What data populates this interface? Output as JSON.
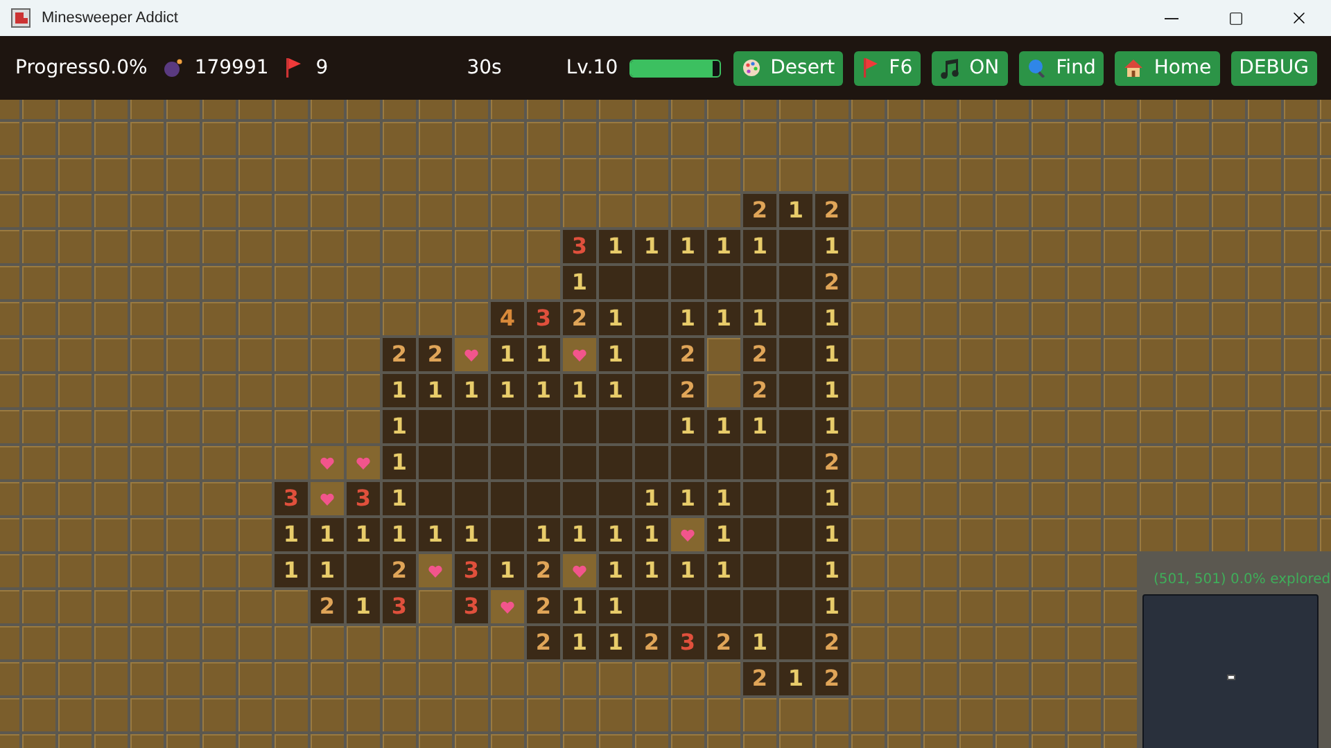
{
  "window": {
    "title": "Minesweeper Addict"
  },
  "toolbar": {
    "progress": "Progress0.0%",
    "mines": "179991",
    "flags": "9",
    "timer": "30s",
    "level_label": "Lv.10",
    "level": 0.92,
    "buttons": [
      {
        "label": "Desert"
      },
      {
        "label": "F6"
      },
      {
        "label": "ON"
      },
      {
        "label": "Find"
      },
      {
        "label": "Home"
      },
      {
        "label": "DEBUG"
      }
    ]
  },
  "board": {
    "rows": [
      {
        "cells": [
          {
            "kind": "hidden"
          },
          {
            "kind": "hidden"
          },
          {
            "kind": "hidden"
          },
          {
            "kind": "hidden"
          },
          {
            "kind": "hidden"
          },
          {
            "kind": "hidden"
          },
          {
            "kind": "hidden"
          },
          {
            "kind": "hidden"
          },
          {
            "kind": "hidden"
          },
          {
            "kind": "hidden"
          },
          {
            "kind": "hidden"
          },
          {
            "kind": "hidden"
          },
          {
            "kind": "hidden"
          },
          {
            "kind": "number",
            "text": "2",
            "color": "#e0a558"
          },
          {
            "kind": "number",
            "text": "1",
            "color": "#e8cc6a"
          },
          {
            "kind": "number",
            "text": "2",
            "color": "#e0a558"
          }
        ]
      },
      {
        "cells": [
          {
            "kind": "hidden"
          },
          {
            "kind": "hidden"
          },
          {
            "kind": "hidden"
          },
          {
            "kind": "hidden"
          },
          {
            "kind": "hidden"
          },
          {
            "kind": "hidden"
          },
          {
            "kind": "hidden"
          },
          {
            "kind": "hidden"
          },
          {
            "kind": "number",
            "text": "3",
            "color": "#e0503c"
          },
          {
            "kind": "number",
            "text": "1",
            "color": "#e8cc6a"
          },
          {
            "kind": "number",
            "text": "1",
            "color": "#e8cc6a"
          },
          {
            "kind": "number",
            "text": "1",
            "color": "#e8cc6a"
          },
          {
            "kind": "number",
            "text": "1",
            "color": "#e8cc6a"
          },
          {
            "kind": "number",
            "text": "1",
            "color": "#e8cc6a"
          },
          {
            "kind": "open"
          },
          {
            "kind": "number",
            "text": "1",
            "color": "#e8cc6a"
          }
        ]
      },
      {
        "cells": [
          {
            "kind": "hidden"
          },
          {
            "kind": "hidden"
          },
          {
            "kind": "hidden"
          },
          {
            "kind": "hidden"
          },
          {
            "kind": "hidden"
          },
          {
            "kind": "hidden"
          },
          {
            "kind": "hidden"
          },
          {
            "kind": "hidden"
          },
          {
            "kind": "number",
            "text": "1",
            "color": "#e8cc6a"
          },
          {
            "kind": "open"
          },
          {
            "kind": "open"
          },
          {
            "kind": "open"
          },
          {
            "kind": "open"
          },
          {
            "kind": "open"
          },
          {
            "kind": "open"
          },
          {
            "kind": "number",
            "text": "2",
            "color": "#e0a558"
          }
        ]
      },
      {
        "cells": [
          {
            "kind": "hidden"
          },
          {
            "kind": "hidden"
          },
          {
            "kind": "hidden"
          },
          {
            "kind": "hidden"
          },
          {
            "kind": "hidden"
          },
          {
            "kind": "hidden"
          },
          {
            "kind": "number",
            "text": "4",
            "color": "#d98a3a"
          },
          {
            "kind": "number",
            "text": "3",
            "color": "#e0503c"
          },
          {
            "kind": "number",
            "text": "2",
            "color": "#e0a558"
          },
          {
            "kind": "number",
            "text": "1",
            "color": "#e8cc6a"
          },
          {
            "kind": "open"
          },
          {
            "kind": "number",
            "text": "1",
            "color": "#e8cc6a"
          },
          {
            "kind": "number",
            "text": "1",
            "color": "#e8cc6a"
          },
          {
            "kind": "number",
            "text": "1",
            "color": "#e8cc6a"
          },
          {
            "kind": "open"
          },
          {
            "kind": "number",
            "text": "1",
            "color": "#e8cc6a"
          }
        ]
      },
      {
        "cells": [
          {
            "kind": "hidden"
          },
          {
            "kind": "hidden"
          },
          {
            "kind": "hidden"
          },
          {
            "kind": "number",
            "text": "2",
            "color": "#e0a558"
          },
          {
            "kind": "number",
            "text": "2",
            "color": "#e0a558"
          },
          {
            "kind": "flag"
          },
          {
            "kind": "number",
            "text": "1",
            "color": "#e8cc6a"
          },
          {
            "kind": "number",
            "text": "1",
            "color": "#e8cc6a"
          },
          {
            "kind": "flag"
          },
          {
            "kind": "number",
            "text": "1",
            "color": "#e8cc6a"
          },
          {
            "kind": "open"
          },
          {
            "kind": "number",
            "text": "2",
            "color": "#e0a558"
          },
          {
            "kind": "hidden"
          },
          {
            "kind": "number",
            "text": "2",
            "color": "#e0a558"
          },
          {
            "kind": "open"
          },
          {
            "kind": "number",
            "text": "1",
            "color": "#e8cc6a"
          }
        ]
      },
      {
        "cells": [
          {
            "kind": "hidden"
          },
          {
            "kind": "hidden"
          },
          {
            "kind": "hidden"
          },
          {
            "kind": "number",
            "text": "1",
            "color": "#e8cc6a"
          },
          {
            "kind": "number",
            "text": "1",
            "color": "#e8cc6a"
          },
          {
            "kind": "number",
            "text": "1",
            "color": "#e8cc6a"
          },
          {
            "kind": "number",
            "text": "1",
            "color": "#e8cc6a"
          },
          {
            "kind": "number",
            "text": "1",
            "color": "#e8cc6a"
          },
          {
            "kind": "number",
            "text": "1",
            "color": "#e8cc6a"
          },
          {
            "kind": "number",
            "text": "1",
            "color": "#e8cc6a"
          },
          {
            "kind": "open"
          },
          {
            "kind": "number",
            "text": "2",
            "color": "#e0a558"
          },
          {
            "kind": "hidden"
          },
          {
            "kind": "number",
            "text": "2",
            "color": "#e0a558"
          },
          {
            "kind": "open"
          },
          {
            "kind": "number",
            "text": "1",
            "color": "#e8cc6a"
          }
        ]
      },
      {
        "cells": [
          {
            "kind": "hidden"
          },
          {
            "kind": "hidden"
          },
          {
            "kind": "hidden"
          },
          {
            "kind": "number",
            "text": "1",
            "color": "#e8cc6a"
          },
          {
            "kind": "open"
          },
          {
            "kind": "open"
          },
          {
            "kind": "open"
          },
          {
            "kind": "open"
          },
          {
            "kind": "open"
          },
          {
            "kind": "open"
          },
          {
            "kind": "open"
          },
          {
            "kind": "number",
            "text": "1",
            "color": "#e8cc6a"
          },
          {
            "kind": "number",
            "text": "1",
            "color": "#e8cc6a"
          },
          {
            "kind": "number",
            "text": "1",
            "color": "#e8cc6a"
          },
          {
            "kind": "open"
          },
          {
            "kind": "number",
            "text": "1",
            "color": "#e8cc6a"
          }
        ]
      },
      {
        "cells": [
          {
            "kind": "hidden"
          },
          {
            "kind": "flag"
          },
          {
            "kind": "flag"
          },
          {
            "kind": "number",
            "text": "1",
            "color": "#e8cc6a"
          },
          {
            "kind": "open"
          },
          {
            "kind": "open"
          },
          {
            "kind": "open"
          },
          {
            "kind": "open"
          },
          {
            "kind": "open"
          },
          {
            "kind": "open"
          },
          {
            "kind": "open"
          },
          {
            "kind": "open"
          },
          {
            "kind": "open"
          },
          {
            "kind": "open"
          },
          {
            "kind": "open"
          },
          {
            "kind": "number",
            "text": "2",
            "color": "#e0a558"
          }
        ]
      },
      {
        "cells": [
          {
            "kind": "number",
            "text": "3",
            "color": "#e0503c"
          },
          {
            "kind": "flag"
          },
          {
            "kind": "number",
            "text": "3",
            "color": "#e0503c"
          },
          {
            "kind": "number",
            "text": "1",
            "color": "#e8cc6a"
          },
          {
            "kind": "open"
          },
          {
            "kind": "open"
          },
          {
            "kind": "open"
          },
          {
            "kind": "open"
          },
          {
            "kind": "open"
          },
          {
            "kind": "open"
          },
          {
            "kind": "number",
            "text": "1",
            "color": "#e8cc6a"
          },
          {
            "kind": "number",
            "text": "1",
            "color": "#e8cc6a"
          },
          {
            "kind": "number",
            "text": "1",
            "color": "#e8cc6a"
          },
          {
            "kind": "open"
          },
          {
            "kind": "open"
          },
          {
            "kind": "number",
            "text": "1",
            "color": "#e8cc6a"
          }
        ]
      },
      {
        "cells": [
          {
            "kind": "number",
            "text": "1",
            "color": "#e8cc6a"
          },
          {
            "kind": "number",
            "text": "1",
            "color": "#e8cc6a"
          },
          {
            "kind": "number",
            "text": "1",
            "color": "#e8cc6a"
          },
          {
            "kind": "number",
            "text": "1",
            "color": "#e8cc6a"
          },
          {
            "kind": "number",
            "text": "1",
            "color": "#e8cc6a"
          },
          {
            "kind": "number",
            "text": "1",
            "color": "#e8cc6a"
          },
          {
            "kind": "open"
          },
          {
            "kind": "number",
            "text": "1",
            "color": "#e8cc6a"
          },
          {
            "kind": "number",
            "text": "1",
            "color": "#e8cc6a"
          },
          {
            "kind": "number",
            "text": "1",
            "color": "#e8cc6a"
          },
          {
            "kind": "number",
            "text": "1",
            "color": "#e8cc6a"
          },
          {
            "kind": "flag"
          },
          {
            "kind": "number",
            "text": "1",
            "color": "#e8cc6a"
          },
          {
            "kind": "open"
          },
          {
            "kind": "open"
          },
          {
            "kind": "number",
            "text": "1",
            "color": "#e8cc6a"
          }
        ]
      },
      {
        "cells": [
          {
            "kind": "number",
            "text": "1",
            "color": "#e8cc6a"
          },
          {
            "kind": "number",
            "text": "1",
            "color": "#e8cc6a"
          },
          {
            "kind": "open"
          },
          {
            "kind": "number",
            "text": "2",
            "color": "#e0a558"
          },
          {
            "kind": "flag"
          },
          {
            "kind": "number",
            "text": "3",
            "color": "#e0503c"
          },
          {
            "kind": "number",
            "text": "1",
            "color": "#e8cc6a"
          },
          {
            "kind": "number",
            "text": "2",
            "color": "#e0a558"
          },
          {
            "kind": "flag"
          },
          {
            "kind": "number",
            "text": "1",
            "color": "#e8cc6a"
          },
          {
            "kind": "number",
            "text": "1",
            "color": "#e8cc6a"
          },
          {
            "kind": "number",
            "text": "1",
            "color": "#e8cc6a"
          },
          {
            "kind": "number",
            "text": "1",
            "color": "#e8cc6a"
          },
          {
            "kind": "open"
          },
          {
            "kind": "open"
          },
          {
            "kind": "number",
            "text": "1",
            "color": "#e8cc6a"
          }
        ]
      },
      {
        "cells": [
          {
            "kind": "hidden"
          },
          {
            "kind": "number",
            "text": "2",
            "color": "#e0a558"
          },
          {
            "kind": "number",
            "text": "1",
            "color": "#e8cc6a"
          },
          {
            "kind": "number",
            "text": "3",
            "color": "#e0503c"
          },
          {
            "kind": "hidden"
          },
          {
            "kind": "number",
            "text": "3",
            "color": "#e0503c"
          },
          {
            "kind": "flag"
          },
          {
            "kind": "number",
            "text": "2",
            "color": "#e0a558"
          },
          {
            "kind": "number",
            "text": "1",
            "color": "#e8cc6a"
          },
          {
            "kind": "number",
            "text": "1",
            "color": "#e8cc6a"
          },
          {
            "kind": "open"
          },
          {
            "kind": "open"
          },
          {
            "kind": "open"
          },
          {
            "kind": "open"
          },
          {
            "kind": "open"
          },
          {
            "kind": "number",
            "text": "1",
            "color": "#e8cc6a"
          }
        ]
      },
      {
        "cells": [
          {
            "kind": "hidden"
          },
          {
            "kind": "hidden"
          },
          {
            "kind": "hidden"
          },
          {
            "kind": "hidden"
          },
          {
            "kind": "hidden"
          },
          {
            "kind": "hidden"
          },
          {
            "kind": "hidden"
          },
          {
            "kind": "number",
            "text": "2",
            "color": "#e0a558"
          },
          {
            "kind": "number",
            "text": "1",
            "color": "#e8cc6a"
          },
          {
            "kind": "number",
            "text": "1",
            "color": "#e8cc6a"
          },
          {
            "kind": "number",
            "text": "2",
            "color": "#e0a558"
          },
          {
            "kind": "number",
            "text": "3",
            "color": "#e0503c"
          },
          {
            "kind": "number",
            "text": "2",
            "color": "#e0a558"
          },
          {
            "kind": "number",
            "text": "1",
            "color": "#e8cc6a"
          },
          {
            "kind": "open"
          },
          {
            "kind": "number",
            "text": "2",
            "color": "#e0a558"
          }
        ]
      },
      {
        "cells": [
          {
            "kind": "hidden"
          },
          {
            "kind": "hidden"
          },
          {
            "kind": "hidden"
          },
          {
            "kind": "hidden"
          },
          {
            "kind": "hidden"
          },
          {
            "kind": "hidden"
          },
          {
            "kind": "hidden"
          },
          {
            "kind": "hidden"
          },
          {
            "kind": "hidden"
          },
          {
            "kind": "hidden"
          },
          {
            "kind": "hidden"
          },
          {
            "kind": "hidden"
          },
          {
            "kind": "hidden"
          },
          {
            "kind": "number",
            "text": "2",
            "color": "#e0a558"
          },
          {
            "kind": "number",
            "text": "1",
            "color": "#e8cc6a"
          },
          {
            "kind": "number",
            "text": "2",
            "color": "#e0a558"
          }
        ]
      }
    ]
  },
  "minimap": {
    "caption": "(501, 501)  0.0% explored"
  }
}
